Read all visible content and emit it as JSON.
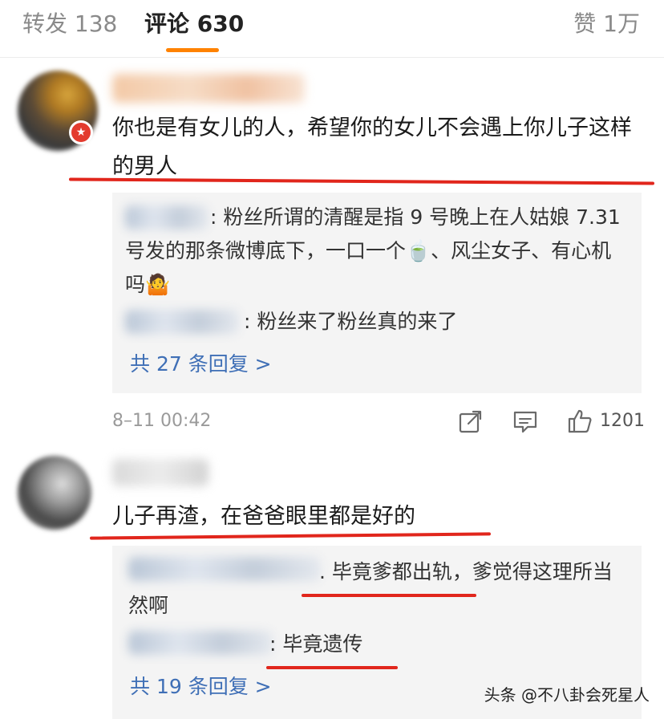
{
  "tabs": {
    "repost": "转发 138",
    "comments": "评论 630",
    "likes": "赞 1万"
  },
  "comment1": {
    "text": "你也是有女儿的人，希望你的女儿不会遇上你儿子这样的男人",
    "reply1": ": 粉丝所谓的清醒是指 9 号晚上在人姑娘 7.31号发的那条微博底下，一口一个🍵、风尘女子、有心机吗🤷",
    "reply2": ": 粉丝来了粉丝真的来了",
    "more_replies": "共 27 条回复 >",
    "timestamp": "8–11 00:42",
    "like_count": "1201"
  },
  "comment2": {
    "text": "儿子再渣，在爸爸眼里都是好的",
    "reply1": ". 毕竟爹都出轨，爹觉得这理所当然啊",
    "reply2": ": 毕竟遗传",
    "more_replies": "共 19 条回复 >"
  },
  "watermark": "头条 @不八卦会死星人",
  "colors": {
    "accent": "#ff8200",
    "link": "#3f6fb6",
    "annotation_red": "#e1261c"
  },
  "icons": [
    "share-icon",
    "comment-icon",
    "like-icon"
  ]
}
